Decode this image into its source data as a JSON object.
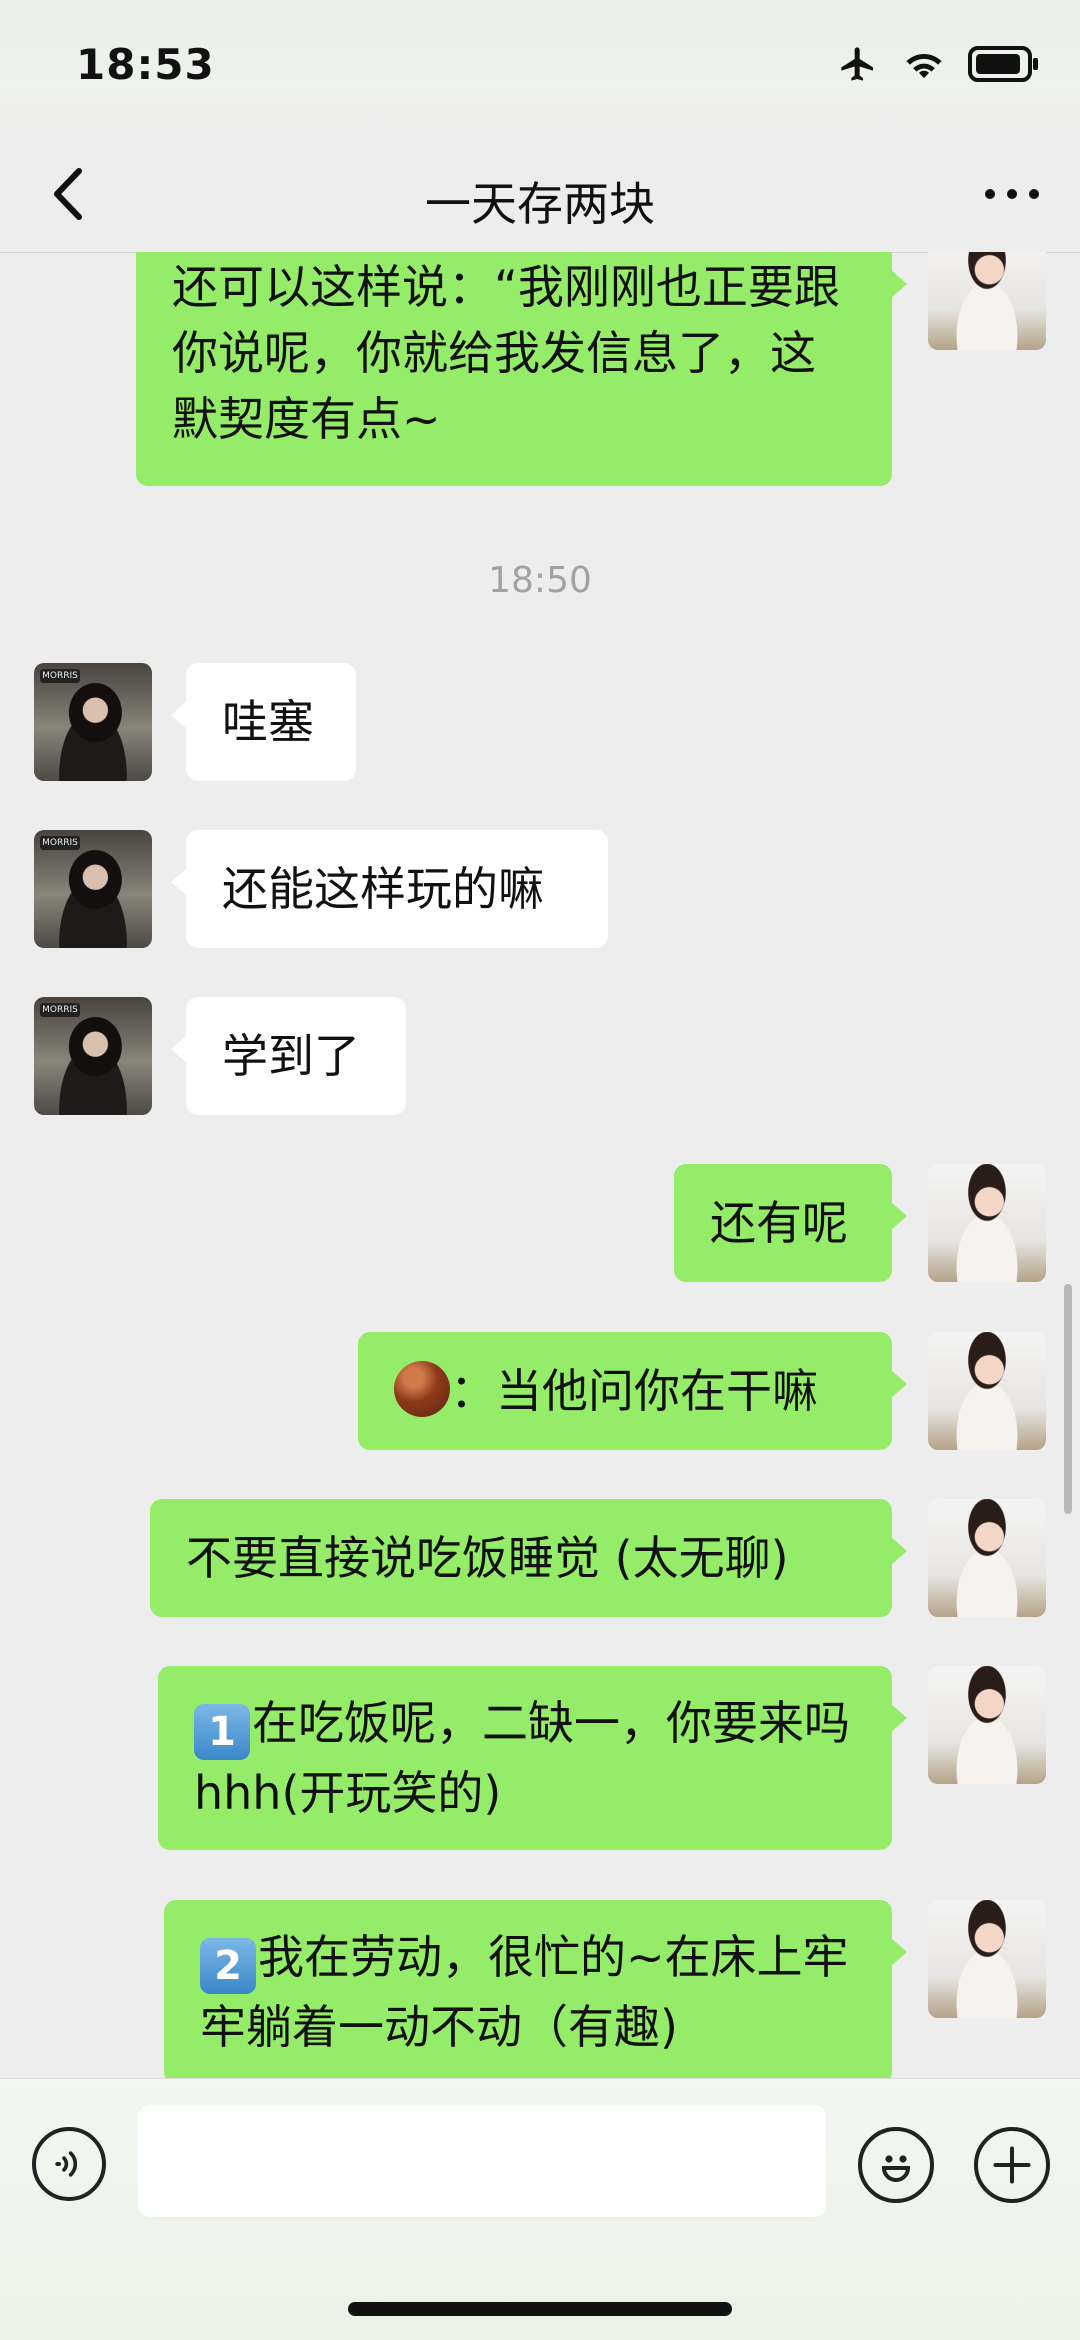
{
  "status_bar": {
    "time": "18:53"
  },
  "header": {
    "title": "一天存两块"
  },
  "chat": {
    "timestamp": "18:50",
    "messages": [
      {
        "sender": "me",
        "text": "还可以这样说：“我刚刚也正要跟你说呢，你就给我发信息了，这默契度有点~"
      },
      {
        "sender": "them",
        "text": "哇塞"
      },
      {
        "sender": "them",
        "text": "还能这样玩的嘛"
      },
      {
        "sender": "them",
        "text": "学到了"
      },
      {
        "sender": "me",
        "text": "还有呢"
      },
      {
        "sender": "me",
        "text": "：当他问你在干嘛",
        "emoji": "chestnut-emoji"
      },
      {
        "sender": "me",
        "text": "不要直接说吃饭睡觉 (太无聊)"
      },
      {
        "sender": "me",
        "badge": "1",
        "text": "在吃饭呢，二缺一，你要来吗 hhh(开玩笑的)"
      },
      {
        "sender": "me",
        "badge": "2",
        "text": "我在劳动，很忙的~在床上牢牢躺着一动不动（有趣)"
      }
    ],
    "avatar_them_tag": "MORRIS"
  },
  "input": {
    "value": ""
  }
}
